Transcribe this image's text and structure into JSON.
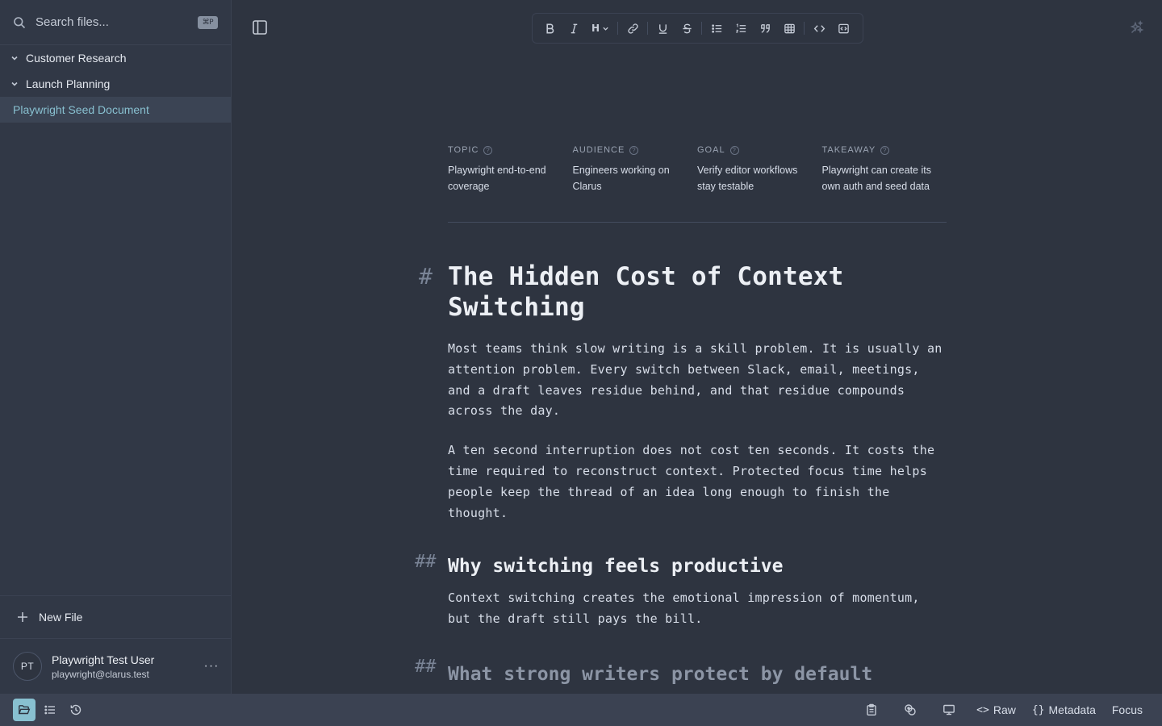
{
  "sidebar": {
    "search": {
      "placeholder": "Search files...",
      "shortcut": "⌘P"
    },
    "folders": [
      {
        "label": "Customer Research"
      },
      {
        "label": "Launch Planning"
      }
    ],
    "active_file": "Playwright Seed Document",
    "new_file_label": "New File",
    "user": {
      "initials": "PT",
      "name": "Playwright Test User",
      "email": "playwright@clarus.test",
      "more": "···"
    }
  },
  "toolbar": {
    "heading_label": "H",
    "icons": [
      "bold-icon",
      "italic-icon",
      "heading-icon",
      "link-icon",
      "underline-icon",
      "strikethrough-icon",
      "bullet-list-icon",
      "numbered-list-icon",
      "quote-icon",
      "table-icon",
      "code-icon",
      "code-block-icon"
    ]
  },
  "metadata": [
    {
      "label": "TOPIC",
      "value": "Playwright end-to-end coverage"
    },
    {
      "label": "AUDIENCE",
      "value": "Engineers working on Clarus"
    },
    {
      "label": "GOAL",
      "value": "Verify editor workflows stay testable"
    },
    {
      "label": "TAKEAWAY",
      "value": "Playwright can create its own auth and seed data"
    }
  ],
  "document": {
    "h1_marker": "#",
    "h2_marker": "##",
    "title": "The Hidden Cost of Context Switching",
    "paragraphs": [
      "Most teams think slow writing is a skill problem. It is usually an attention problem. Every switch between Slack, email, meetings, and a draft leaves residue behind, and that residue compounds across the day.",
      "A ten second interruption does not cost ten seconds. It costs the time required to reconstruct context. Protected focus time helps people keep the thread of an idea long enough to finish the thought."
    ],
    "section1_heading": "Why switching feels productive",
    "section1_paragraph": "Context switching creates the emotional impression of momentum, but the draft still pays the bill.",
    "section2_heading": "What strong writers protect by default"
  },
  "statusbar": {
    "raw_label": "Raw",
    "raw_glyph": "<>",
    "metadata_label": "Metadata",
    "metadata_glyph": "{}",
    "focus_label": "Focus"
  },
  "colors": {
    "background": "#2e3440",
    "sidebar": "#313846",
    "accent": "#88c0d0",
    "statusbar": "#3b4252"
  }
}
